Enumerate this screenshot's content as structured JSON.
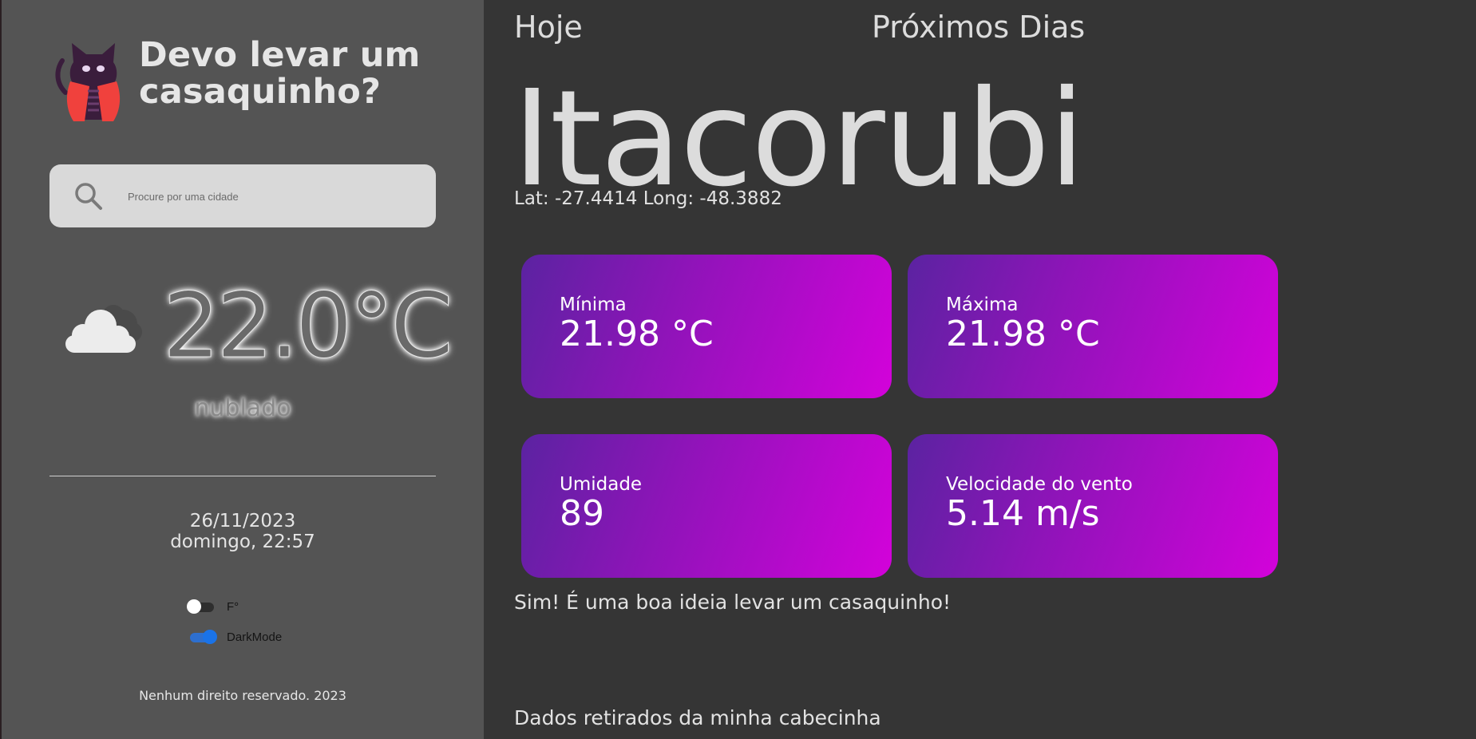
{
  "header": {
    "title": "Devo levar um casaquinho?",
    "logo_icon": "vampire-cat-icon"
  },
  "search": {
    "placeholder": "Procure por uma cidade",
    "value": "",
    "icon": "search-icon"
  },
  "current": {
    "icon": "cloud-icon",
    "temperature": "22.0°C",
    "description": "nublado"
  },
  "datetime": {
    "date": "26/11/2023",
    "weekday_time": "domingo, 22:57"
  },
  "toggles": [
    {
      "label": "F°",
      "on": false
    },
    {
      "label": "DarkMode",
      "on": true
    }
  ],
  "footer": {
    "text": "Nenhum direito reservado. 2023"
  },
  "tabs": [
    {
      "label": "Hoje"
    },
    {
      "label": "Próximos Dias"
    }
  ],
  "location": {
    "city": "Itacorubi",
    "coords": "Lat: -27.4414 Long: -48.3882"
  },
  "cards": [
    {
      "label": "Mínima",
      "value": "21.98 °C"
    },
    {
      "label": "Máxima",
      "value": "21.98 °C"
    },
    {
      "label": "Umidade",
      "value": "89"
    },
    {
      "label": "Velocidade do vento",
      "value": "5.14 m/s"
    }
  ],
  "advice": "Sim! É uma boa ideia levar um casaquinho!",
  "source": "Dados retirados da minha cabecinha",
  "colors": {
    "sidebar_bg": "#545454",
    "main_bg": "#353535",
    "card_gradient_start": "#5b23a1",
    "card_gradient_end": "#d302da",
    "toggle_on": "#1a73e8"
  }
}
